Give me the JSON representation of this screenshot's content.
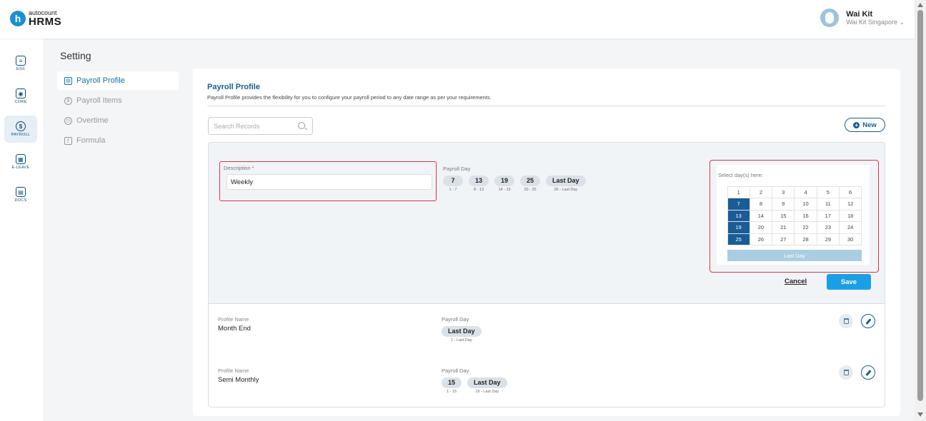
{
  "brand": {
    "small": "autocount",
    "big": "HRMS",
    "mark": "h"
  },
  "user": {
    "name": "Wai Kit",
    "company": "Wai Kit Singapore ⌄"
  },
  "nav": [
    {
      "label": "ESS",
      "icon": "ess-icon",
      "glyph": "≡"
    },
    {
      "label": "CORE",
      "icon": "core-icon",
      "glyph": "◉"
    },
    {
      "label": "PAYROLL",
      "icon": "payroll-icon",
      "glyph": "$"
    },
    {
      "label": "E-LEAVE",
      "icon": "calendar-icon",
      "glyph": "▦"
    },
    {
      "label": "DOCS",
      "icon": "docs-icon",
      "glyph": "▤"
    }
  ],
  "page": {
    "title": "Setting"
  },
  "settings_menu": [
    {
      "label": "Payroll Profile",
      "glyph": "▤"
    },
    {
      "label": "Payroll Items",
      "glyph": "$"
    },
    {
      "label": "Overtime",
      "glyph": "◷"
    },
    {
      "label": "Formula",
      "glyph": "ƒ"
    }
  ],
  "card": {
    "title": "Payroll Profile",
    "description": "Payroll Profile provides the flexibility for you to configure your payroll period to any date range as per your requirements."
  },
  "search": {
    "placeholder": "Search Records"
  },
  "new_button": {
    "label": "New",
    "icon_glyph": "+"
  },
  "edit_form": {
    "description_label": "Description *",
    "description_value": "Weekly",
    "payroll_day_label": "Payroll Day",
    "payroll_days": [
      {
        "value": "7",
        "range": "1 - 7"
      },
      {
        "value": "13",
        "range": "8 - 13"
      },
      {
        "value": "19",
        "range": "14 - 19"
      },
      {
        "value": "25",
        "range": "20 - 25"
      },
      {
        "value": "Last Day",
        "range": "26 - Last Day"
      }
    ],
    "calendar_label": "Select day(s) here:",
    "calendar_days": [
      "1",
      "2",
      "3",
      "4",
      "5",
      "6",
      "7",
      "8",
      "9",
      "10",
      "11",
      "12",
      "13",
      "14",
      "15",
      "16",
      "17",
      "18",
      "19",
      "20",
      "21",
      "22",
      "23",
      "24",
      "25",
      "26",
      "27",
      "28",
      "29",
      "30"
    ],
    "calendar_selected": [
      "7",
      "13",
      "19",
      "25"
    ],
    "calendar_last_day": "Last Day",
    "cancel_label": "Cancel",
    "save_label": "Save"
  },
  "records": [
    {
      "name_label": "Profile Name",
      "name": "Month End",
      "payroll_day_label": "Payroll Day",
      "days": [
        {
          "value": "Last Day",
          "range": "1 - Last Day"
        }
      ]
    },
    {
      "name_label": "Profile Name",
      "name": "Semi Monthly",
      "payroll_day_label": "Payroll Day",
      "days": [
        {
          "value": "15",
          "range": "1 - 15"
        },
        {
          "value": "Last Day",
          "range": "16 - Last Day"
        }
      ]
    }
  ],
  "colors": {
    "primary": "#1a5c96",
    "accent": "#1a9fe6",
    "highlight": "#d9363e",
    "selected_day": "#1a5c96"
  }
}
